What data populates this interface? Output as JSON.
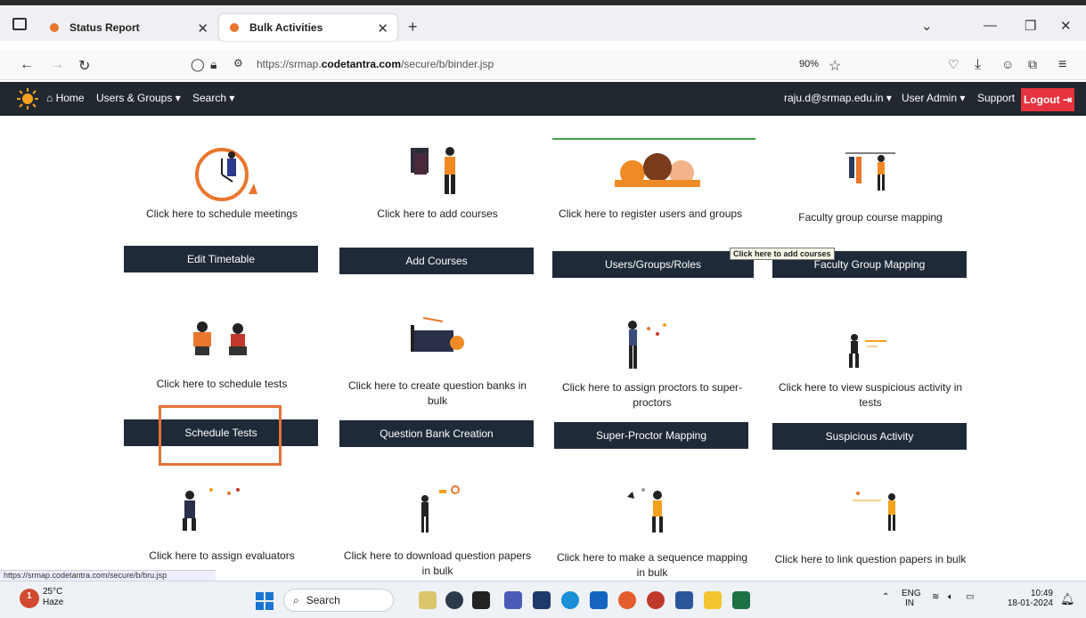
{
  "browser": {
    "tabs": [
      {
        "label": "Status Report"
      },
      {
        "label": "Bulk Activities"
      }
    ],
    "new_tab": "+",
    "url_prefix": "https://srmap.",
    "url_domain": "codetantra.com",
    "url_suffix": "/secure/b/binder.jsp",
    "zoom": "90%",
    "status_url": "https://srmap.codetantra.com/secure/b/bru.jsp"
  },
  "header": {
    "home": "Home",
    "users_groups": "Users & Groups ▾",
    "search": "Search ▾",
    "user_email": "raju.d@srmap.edu.in ▾",
    "user_admin": "User Admin ▾",
    "support": "Support",
    "logout": "Logout"
  },
  "cards": [
    {
      "caption": "Click here to schedule meetings",
      "button": "Edit Timetable"
    },
    {
      "caption": "Click here to add courses",
      "button": "Add Courses"
    },
    {
      "caption": "Click here to register users and groups",
      "button": "Users/Groups/Roles"
    },
    {
      "caption": "Faculty group course mapping",
      "button": "Faculty Group Mapping"
    },
    {
      "caption": "Click here to schedule tests",
      "button": "Schedule Tests"
    },
    {
      "caption": "Click here to create question banks in bulk",
      "button": "Question Bank Creation"
    },
    {
      "caption": "Click here to assign proctors to super-proctors",
      "button": "Super-Proctor Mapping"
    },
    {
      "caption": "Click here to view suspicious activity in tests",
      "button": "Suspicious Activity"
    },
    {
      "caption": "Click here to assign evaluators"
    },
    {
      "caption": "Click here to download question papers in bulk"
    },
    {
      "caption": "Click here to make a sequence mapping in bulk"
    },
    {
      "caption": "Click here to link question papers in bulk"
    }
  ],
  "tooltip": "Click here to add courses",
  "taskbar": {
    "weather_badge": "1",
    "weather_temp": "25°C",
    "weather_desc": "Haze",
    "search": "Search",
    "lang": "ENG",
    "region": "IN",
    "time": "10:49",
    "date": "18-01-2024"
  }
}
